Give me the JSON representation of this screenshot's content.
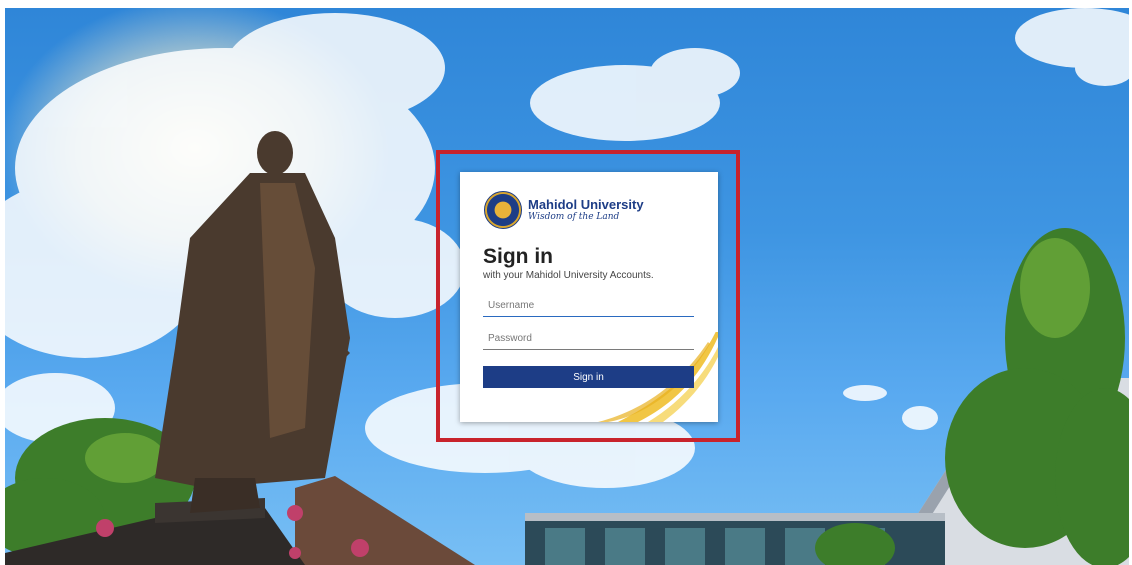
{
  "logo": {
    "brand": "Mahidol University",
    "tagline": "Wisdom of the Land"
  },
  "signin": {
    "title": "Sign in",
    "subtitle": "with your Mahidol University Accounts.",
    "username_placeholder": "Username",
    "password_placeholder": "Password",
    "button_label": "Sign in"
  },
  "colors": {
    "brand_blue": "#1d3d86",
    "highlight_red": "#c8232c",
    "accent_gold": "#f0c030"
  }
}
